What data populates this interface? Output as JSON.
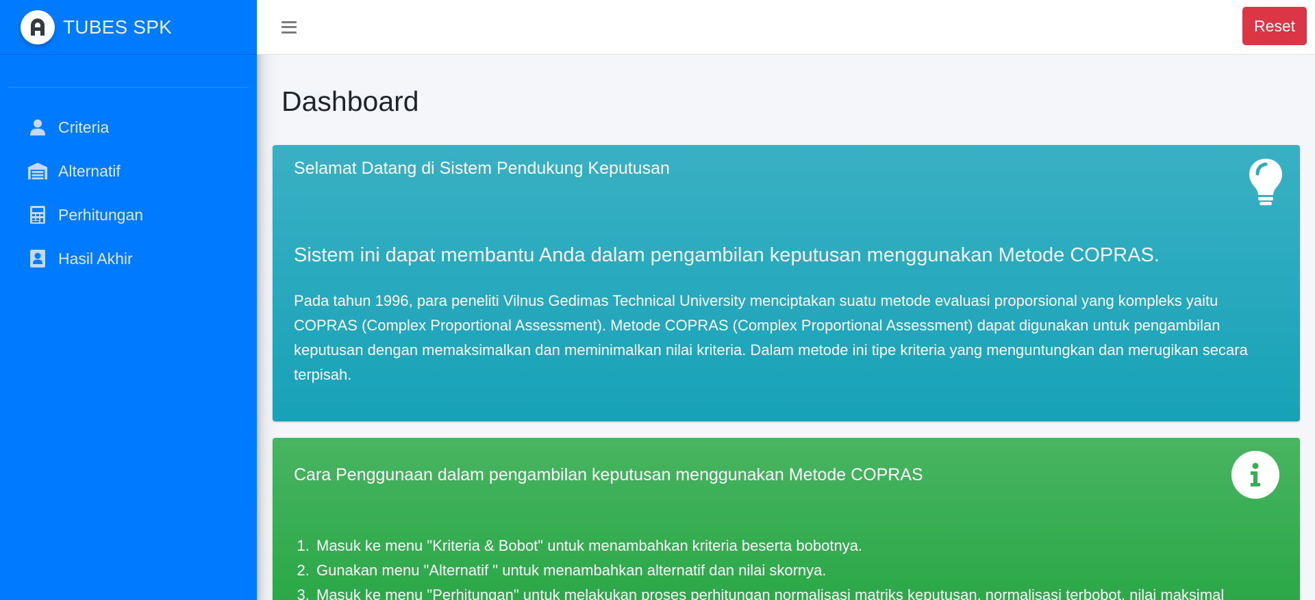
{
  "sidebar": {
    "brand_text": "TUBES SPK",
    "items": [
      {
        "label": "Criteria",
        "icon": "user-icon"
      },
      {
        "label": "Alternatif",
        "icon": "warehouse-icon"
      },
      {
        "label": "Perhitungan",
        "icon": "calculator-icon"
      },
      {
        "label": "Hasil Akhir",
        "icon": "user-badge-icon"
      }
    ],
    "bg_color": "#007bff"
  },
  "topbar": {
    "reset_label": "Reset",
    "reset_color": "#dc3545"
  },
  "main": {
    "page_title": "Dashboard",
    "welcome_card": {
      "title": "Selamat Datang di Sistem Pendukung Keputusan",
      "lead": "Sistem ini dapat membantu Anda dalam pengambilan keputusan menggunakan Metode COPRAS.",
      "paragraph": "Pada tahun 1996, para peneliti Vilnus Gedimas Technical University menciptakan suatu metode evaluasi proporsional yang kompleks yaitu COPRAS (Complex Proportional Assessment). Metode COPRAS (Complex Proportional Assessment) dapat digunakan untuk pengambilan keputusan dengan memaksimalkan dan meminimalkan nilai kriteria. Dalam metode ini tipe kriteria yang menguntungkan dan merugikan secara terpisah.",
      "color": "#17a2b8",
      "icon": "lightbulb-icon"
    },
    "usage_card": {
      "title": "Cara Penggunaan dalam pengambilan keputusan menggunakan Metode COPRAS",
      "steps": [
        "Masuk ke menu \"Kriteria & Bobot\" untuk menambahkan kriteria beserta bobotnya.",
        "Gunakan menu \"Alternatif \" untuk menambahkan alternatif dan nilai skornya.",
        "Masuk ke menu \"Perhitungan\" untuk melakukan proses perhitungan normalisasi matriks keputusan, normalisasi terbobot, nilai maksimal"
      ],
      "color": "#28a745",
      "icon": "info-icon"
    }
  }
}
